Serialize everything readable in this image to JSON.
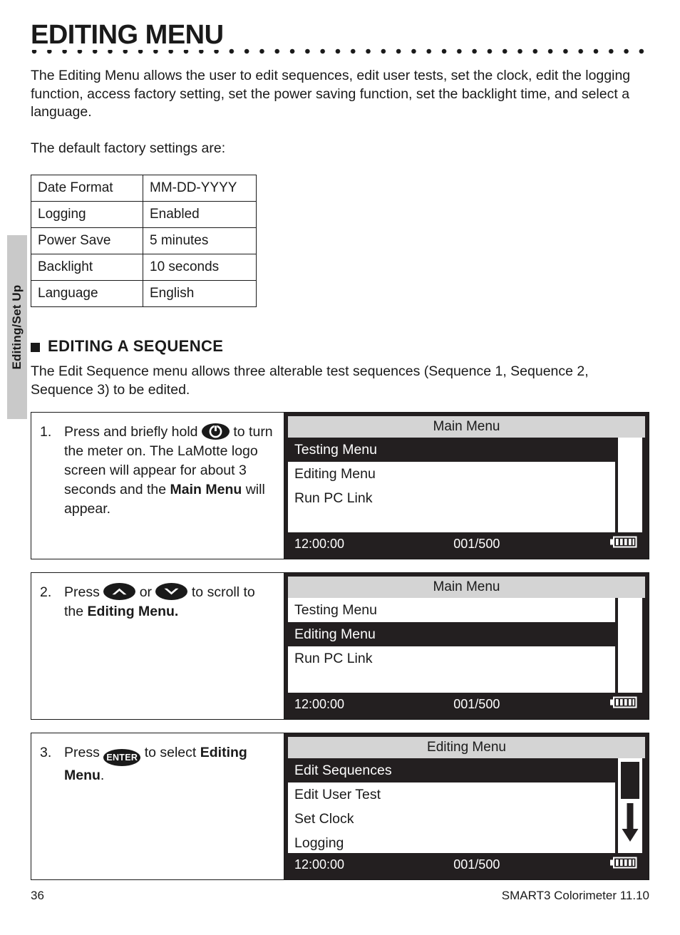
{
  "side_tab": {
    "label": "Editing/Set Up"
  },
  "header": {
    "title": "EDITING MENU"
  },
  "intro": {
    "paragraph": "The Editing Menu allows the user to edit sequences, edit user tests, set the clock, edit the logging function, access factory setting, set the power saving function, set the backlight time, and select a language.",
    "defaults_lead": "The default factory settings are:"
  },
  "settings_table": {
    "rows": [
      {
        "setting": "Date Format",
        "value": "MM-DD-YYYY"
      },
      {
        "setting": "Logging",
        "value": "Enabled"
      },
      {
        "setting": "Power Save",
        "value": "5 minutes"
      },
      {
        "setting": "Backlight",
        "value": "10 seconds"
      },
      {
        "setting": "Language",
        "value": "English"
      }
    ]
  },
  "section": {
    "heading": "EDITING A SEQUENCE",
    "paragraph": "The Edit Sequence menu allows three alterable test sequences (Sequence 1, Sequence 2, Sequence 3) to be edited."
  },
  "steps": [
    {
      "number": "1.",
      "text_before": "Press and briefly hold",
      "key": "power-button-icon",
      "key_label": "",
      "text_mid": "to turn the meter on. The LaMotte logo screen will appear for about 3 seconds and the",
      "text_bold": "Main Menu",
      "text_after": "will appear.",
      "screen": {
        "title": "Main Menu",
        "items": [
          {
            "label": "Testing Menu",
            "selected": true
          },
          {
            "label": "Editing Menu",
            "selected": false
          },
          {
            "label": "Run PC Link",
            "selected": false
          }
        ],
        "scroll_arrow": "none",
        "status": {
          "time": "12:00:00",
          "count": "001/500",
          "battery": "battery-full-icon"
        }
      }
    },
    {
      "number": "2.",
      "text_before": "Press",
      "key": "up-arrow-icon",
      "key2": "down-arrow-icon",
      "conjunction": "or",
      "text_mid": "to scroll to the",
      "text_bold": "Editing Menu.",
      "text_after": "",
      "screen": {
        "title": "Main Menu",
        "items": [
          {
            "label": "Testing Menu",
            "selected": false
          },
          {
            "label": "Editing Menu",
            "selected": true
          },
          {
            "label": "Run PC Link",
            "selected": false
          }
        ],
        "scroll_arrow": "none",
        "status": {
          "time": "12:00:00",
          "count": "001/500",
          "battery": "battery-full-icon"
        }
      }
    },
    {
      "number": "3.",
      "text_before": "Press",
      "key": "enter-button-icon",
      "key_label": "ENTER",
      "text_mid": "to select",
      "text_bold": "Editing Menu",
      "text_after": ".",
      "screen": {
        "title": "Editing Menu",
        "items": [
          {
            "label": "Edit Sequences",
            "selected": true
          },
          {
            "label": "Edit User Test",
            "selected": false
          },
          {
            "label": "Set Clock",
            "selected": false
          },
          {
            "label": "Logging",
            "selected": false
          }
        ],
        "scroll_arrow": "down",
        "status": {
          "time": "12:00:00",
          "count": "001/500",
          "battery": "battery-full-icon"
        }
      }
    }
  ],
  "footer": {
    "page_number": "36",
    "document_title": "SMART3 Colorimeter 11.10"
  }
}
